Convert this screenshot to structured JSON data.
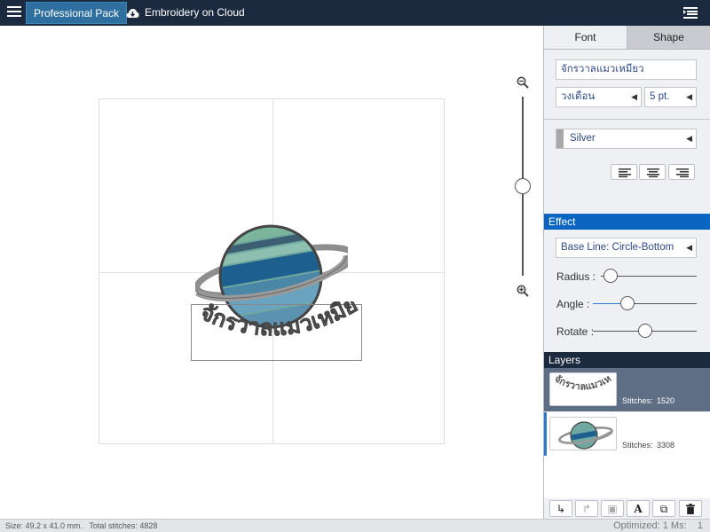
{
  "topbar": {
    "pack_label": "Professional Pack",
    "cloud_label": "Embroidery on Cloud"
  },
  "tabs": [
    {
      "label": "Font"
    },
    {
      "label": "Shape"
    }
  ],
  "font": {
    "text_value": "จักรวาลแมวเหมียว",
    "font_name": "วงเดือน",
    "font_size": "5 pt.",
    "color_name": "Silver"
  },
  "colors": {
    "swatch": "#a8a8a8",
    "effect_header": "#0a66c2",
    "topbar": "#1c2a40"
  },
  "effect": {
    "header": "Effect",
    "base_line": "Base Line: Circle-Bottom",
    "radius_label": "Radius :",
    "angle_label": "Angle :",
    "rotate_label": "Rotate :",
    "radius": 0.1,
    "angle": 0.33,
    "rotate": 0.5
  },
  "layers": {
    "header": "Layers",
    "items": [
      {
        "stitches_label": "Stitches:",
        "stitches": "1520"
      },
      {
        "stitches_label": "Stitches:",
        "stitches": "3308"
      }
    ]
  },
  "canvas": {
    "artwork_text": "จักรวาลแมวเหมียว"
  },
  "zoom": {
    "level": 0.5
  },
  "toolbar": {
    "text_tool": "A"
  },
  "status": {
    "size": "Size: 49.2 x 41.0 mm.",
    "total": "Total stitches: 4828",
    "optimized": "Optimized: 1 Ms:",
    "count": "1"
  }
}
